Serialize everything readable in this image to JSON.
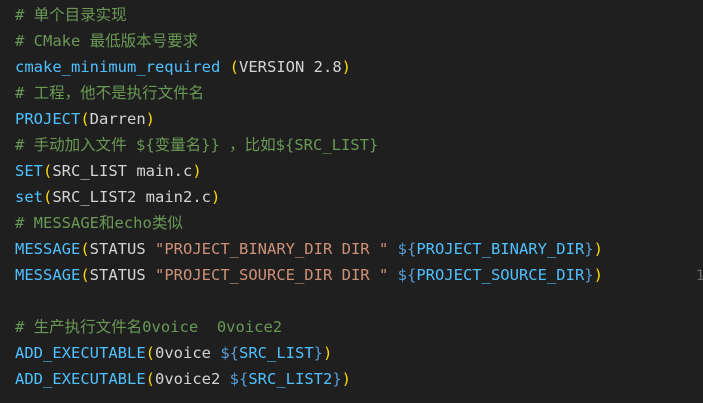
{
  "editor": {
    "lines": [
      {
        "key": "l0",
        "tokens": [
          {
            "cls": "c",
            "text": "# 单个目录实现"
          }
        ]
      },
      {
        "key": "l1",
        "tokens": [
          {
            "cls": "c",
            "text": "# CMake 最低版本号要求"
          }
        ]
      },
      {
        "key": "l2",
        "tokens": [
          {
            "cls": "f",
            "text": "cmake_minimum_required"
          },
          {
            "cls": "t",
            "text": " "
          },
          {
            "cls": "p",
            "text": "("
          },
          {
            "cls": "t",
            "text": "VERSION 2.8"
          },
          {
            "cls": "p",
            "text": ")"
          }
        ]
      },
      {
        "key": "l3",
        "tokens": [
          {
            "cls": "c",
            "text": "# 工程，他不是执行文件名"
          }
        ]
      },
      {
        "key": "l4",
        "tokens": [
          {
            "cls": "f",
            "text": "PROJECT"
          },
          {
            "cls": "p",
            "text": "("
          },
          {
            "cls": "t",
            "text": "Darren"
          },
          {
            "cls": "p",
            "text": ")"
          }
        ]
      },
      {
        "key": "l5",
        "tokens": [
          {
            "cls": "c",
            "text": "# 手动加入文件 ${变量名}} ，比如${SRC_LIST}"
          }
        ]
      },
      {
        "key": "l6",
        "tokens": [
          {
            "cls": "f",
            "text": "SET"
          },
          {
            "cls": "p",
            "text": "("
          },
          {
            "cls": "t",
            "text": "SRC_LIST main.c"
          },
          {
            "cls": "p",
            "text": ")"
          }
        ]
      },
      {
        "key": "l7",
        "tokens": [
          {
            "cls": "f",
            "text": "set"
          },
          {
            "cls": "p",
            "text": "("
          },
          {
            "cls": "t",
            "text": "SRC_LIST2 main2.c"
          },
          {
            "cls": "p",
            "text": ")"
          }
        ]
      },
      {
        "key": "l8",
        "tokens": [
          {
            "cls": "c",
            "text": "# MESSAGE和echo类似"
          }
        ]
      },
      {
        "key": "l9",
        "tokens": [
          {
            "cls": "f",
            "text": "MESSAGE"
          },
          {
            "cls": "p",
            "text": "("
          },
          {
            "cls": "t",
            "text": "STATUS "
          },
          {
            "cls": "s",
            "text": "\"PROJECT_BINARY_DIR DIR \""
          },
          {
            "cls": "t",
            "text": " "
          },
          {
            "cls": "v",
            "text": "${"
          },
          {
            "cls": "f",
            "text": "PROJECT_BINARY_DIR"
          },
          {
            "cls": "v",
            "text": "}"
          },
          {
            "cls": "p",
            "text": ")"
          }
        ]
      },
      {
        "key": "l10",
        "tokens": [
          {
            "cls": "f",
            "text": "MESSAGE"
          },
          {
            "cls": "p",
            "text": "("
          },
          {
            "cls": "t",
            "text": "STATUS "
          },
          {
            "cls": "s",
            "text": "\"PROJECT_SOURCE_DIR DIR \""
          },
          {
            "cls": "t",
            "text": " "
          },
          {
            "cls": "v",
            "text": "${"
          },
          {
            "cls": "f",
            "text": "PROJECT_SOURCE_DIR"
          },
          {
            "cls": "v",
            "text": "}"
          },
          {
            "cls": "p",
            "text": ")"
          }
        ]
      },
      {
        "key": "l11",
        "tokens": []
      },
      {
        "key": "l12",
        "tokens": [
          {
            "cls": "c",
            "text": "# 生产执行文件名0voice  0voice2"
          }
        ]
      },
      {
        "key": "l13",
        "tokens": [
          {
            "cls": "f",
            "text": "ADD_EXECUTABLE"
          },
          {
            "cls": "p",
            "text": "("
          },
          {
            "cls": "t",
            "text": "0voice "
          },
          {
            "cls": "v",
            "text": "${"
          },
          {
            "cls": "f",
            "text": "SRC_LIST"
          },
          {
            "cls": "v",
            "text": "}"
          },
          {
            "cls": "p",
            "text": ")"
          }
        ]
      },
      {
        "key": "l14",
        "tokens": [
          {
            "cls": "f",
            "text": "ADD_EXECUTABLE"
          },
          {
            "cls": "p",
            "text": "("
          },
          {
            "cls": "t",
            "text": "0voice2 "
          },
          {
            "cls": "v",
            "text": "${"
          },
          {
            "cls": "f",
            "text": "SRC_LIST2"
          },
          {
            "cls": "v",
            "text": "}"
          },
          {
            "cls": "p",
            "text": ")"
          }
        ]
      }
    ],
    "side_hint": "1"
  },
  "colors": {
    "background": "#1f1f1f",
    "comment": "#6a9955",
    "function": "#4fc1ff",
    "paren": "#ffd700",
    "text": "#d4d4d4",
    "string": "#ce9178",
    "variable_brace": "#569cd6"
  }
}
